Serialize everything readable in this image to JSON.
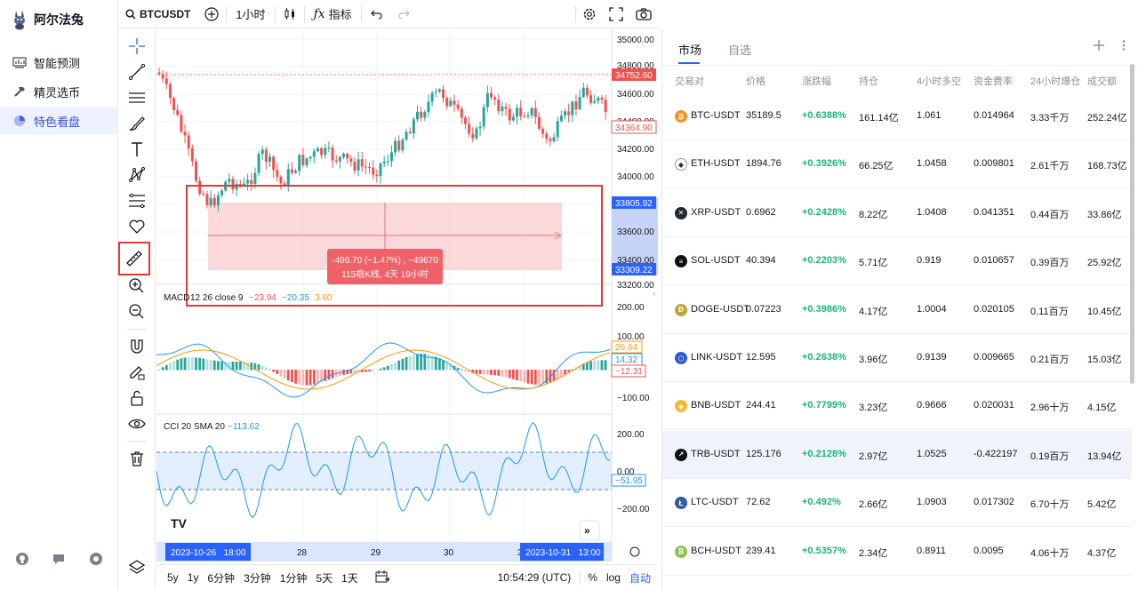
{
  "app": {
    "name": "阿尔法兔"
  },
  "nav": {
    "items": [
      {
        "label": "智能预测",
        "icon": "chart-board-icon",
        "active": false
      },
      {
        "label": "精灵选币",
        "icon": "hammer-icon",
        "active": false
      },
      {
        "label": "特色看盘",
        "icon": "pie-chart-icon",
        "active": true
      }
    ],
    "bottom_icons": [
      "github-icon",
      "chat-icon",
      "settings-circle-icon"
    ]
  },
  "toolbar": {
    "symbol": "BTCUSDT",
    "interval": "1小时",
    "indicators": "指标"
  },
  "chart": {
    "price_axis": [
      "35000.00",
      "34800.00",
      "34600.00",
      "34400.00",
      "34200.00",
      "34000.00",
      "33800.00",
      "33600.00",
      "33400.00",
      "33200.00"
    ],
    "price_tags": {
      "high": "34752.60",
      "last": "34364.90",
      "range_top": "33805.92",
      "range_bottom": "33309.22"
    },
    "measure": {
      "line1": "-496.70 (−1.47%) , −49670",
      "line2": "115根K线, 4天 19小时"
    },
    "macd": {
      "title": "MACD",
      "params": "12 26 close 9",
      "v1": "−23.94",
      "v2": "−20.35",
      "v3": "3.60",
      "axis": [
        "200.00",
        "100.00",
        "−100.00"
      ],
      "tags": [
        "26.64",
        "14.32",
        "−12.31"
      ]
    },
    "cci": {
      "title": "CCI",
      "params": "20 SMA 20",
      "v1": "−113.62",
      "axis": [
        "200.00",
        "0.00",
        "−200.00"
      ],
      "tag": "−51.95"
    },
    "time_axis": {
      "start": "2023-10-26   18:00",
      "labels": [
        "28",
        "29",
        "30",
        "3"
      ],
      "end": "2023-10-31   13:00"
    },
    "colors": {
      "up": "#26a69a",
      "down": "#ef5350",
      "macd": "#2196f3",
      "signal": "#ff9800",
      "cci": "#2196f3",
      "selection": "#e53935"
    }
  },
  "bottombar": {
    "ranges": [
      "5y",
      "1y",
      "6分钟",
      "3分钟",
      "1分钟",
      "5天",
      "1天"
    ],
    "time": "10:54:29 (UTC)",
    "percent": "%",
    "log": "log",
    "auto": "自动"
  },
  "panel": {
    "tabs": [
      "市场",
      "自选"
    ],
    "headers": [
      "交易对",
      "价格",
      "涨跌幅",
      "持仓",
      "4小时多空",
      "资金费率",
      "24小时爆仓",
      "成交额"
    ],
    "rows": [
      {
        "pair": "BTC-USDT",
        "price": "35189.5",
        "change": "+0.6388%",
        "oi": "161.14亿",
        "ls": "1.061",
        "funding": "0.014964",
        "liq": "3.33千万",
        "vol": "252.24亿",
        "color": "#f7931a",
        "glyph": "₿"
      },
      {
        "pair": "ETH-USDT",
        "price": "1894.76",
        "change": "+0.3926%",
        "oi": "66.25亿",
        "ls": "1.0458",
        "funding": "0.009801",
        "liq": "2.61千万",
        "vol": "168.73亿",
        "color": "#ffffff",
        "glyph": "◆"
      },
      {
        "pair": "XRP-USDT",
        "price": "0.6962",
        "change": "+0.2428%",
        "oi": "8.22亿",
        "ls": "1.0408",
        "funding": "0.041351",
        "liq": "0.44百万",
        "vol": "33.86亿",
        "color": "#23292f",
        "glyph": "✕"
      },
      {
        "pair": "SOL-USDT",
        "price": "40.394",
        "change": "+0.2203%",
        "oi": "5.71亿",
        "ls": "0.919",
        "funding": "0.010657",
        "liq": "0.39百万",
        "vol": "25.92亿",
        "color": "#111111",
        "glyph": "≡"
      },
      {
        "pair": "DOGE-USDT",
        "price": "0.07223",
        "change": "+0.3986%",
        "oi": "4.17亿",
        "ls": "1.0004",
        "funding": "0.020105",
        "liq": "0.11百万",
        "vol": "10.45亿",
        "color": "#c2a633",
        "glyph": "Ð"
      },
      {
        "pair": "LINK-USDT",
        "price": "12.595",
        "change": "+0.2638%",
        "oi": "3.96亿",
        "ls": "0.9139",
        "funding": "0.009665",
        "liq": "0.21百万",
        "vol": "15.03亿",
        "color": "#2a5ada",
        "glyph": "⬡"
      },
      {
        "pair": "BNB-USDT",
        "price": "244.41",
        "change": "+0.7799%",
        "oi": "3.23亿",
        "ls": "0.9666",
        "funding": "0.020031",
        "liq": "2.96十万",
        "vol": "4.15亿",
        "color": "#f3ba2f",
        "glyph": "◈"
      },
      {
        "pair": "TRB-USDT",
        "price": "125.176",
        "change": "+0.2128%",
        "oi": "2.97亿",
        "ls": "1.0525",
        "funding": "-0.422197",
        "liq": "0.19百万",
        "vol": "13.94亿",
        "color": "#111111",
        "glyph": "↗"
      },
      {
        "pair": "LTC-USDT",
        "price": "72.62",
        "change": "+0.492%",
        "oi": "2.66亿",
        "ls": "1.0903",
        "funding": "0.017302",
        "liq": "6.70十万",
        "vol": "5.42亿",
        "color": "#345d9d",
        "glyph": "Ł"
      },
      {
        "pair": "BCH-USDT",
        "price": "239.41",
        "change": "+0.5357%",
        "oi": "2.34亿",
        "ls": "0.8911",
        "funding": "0.0095",
        "liq": "4.06十万",
        "vol": "4.37亿",
        "color": "#8dc351",
        "glyph": "₿"
      }
    ]
  }
}
